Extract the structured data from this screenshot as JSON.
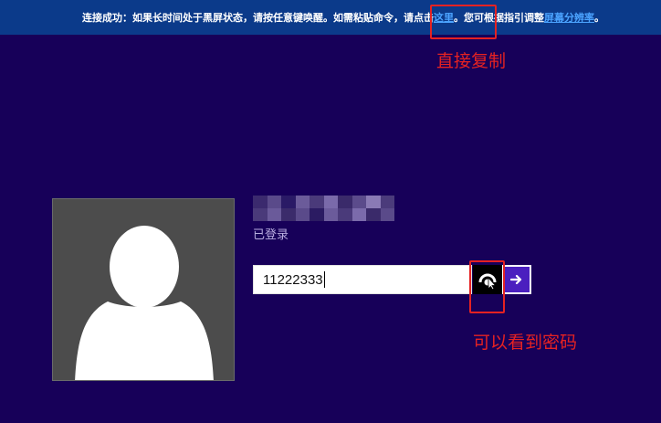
{
  "banner": {
    "text_before_link": "连接成功：如果长时间处于黑屏状态，请按任意键唤醒。如需粘贴命令，请点击",
    "link_here": "这里",
    "text_middle": "。您可根据指引调整",
    "link_resolution": "屏幕分辨率",
    "text_end": "。"
  },
  "login": {
    "status": "已登录",
    "password_value": "11222333",
    "submit_icon": "arrow-right-icon",
    "reveal_icon": "eye-icon"
  },
  "annotations": {
    "copy_label": "直接复制",
    "reveal_label": "可以看到密码"
  },
  "colors": {
    "background": "#170059",
    "banner": "#0b3a8a",
    "link": "#4ba3ff",
    "annotation": "#e52222",
    "submit": "#4b1fbf"
  }
}
